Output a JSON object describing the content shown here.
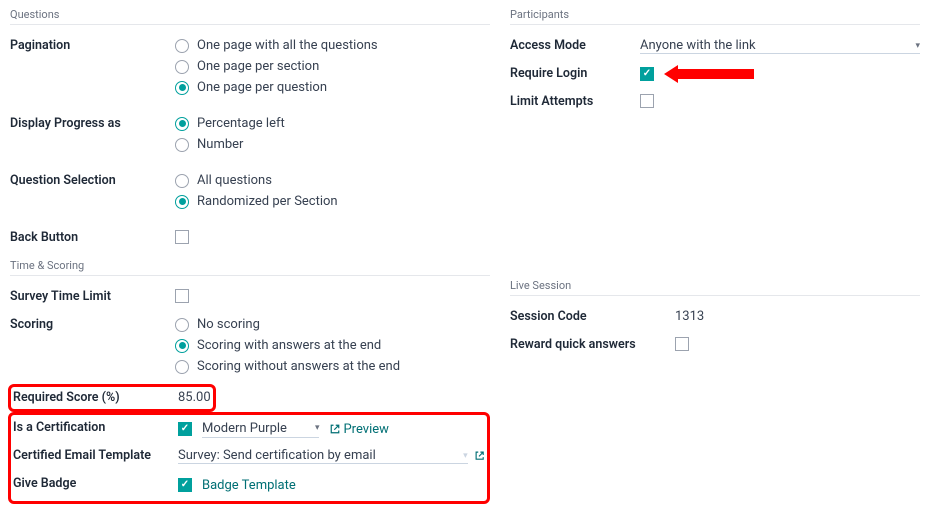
{
  "questions": {
    "section_title": "Questions",
    "pagination": {
      "label": "Pagination",
      "options": [
        {
          "label": "One page with all the questions",
          "selected": false
        },
        {
          "label": "One page per section",
          "selected": false
        },
        {
          "label": "One page per question",
          "selected": true
        }
      ]
    },
    "display_progress": {
      "label": "Display Progress as",
      "options": [
        {
          "label": "Percentage left",
          "selected": true
        },
        {
          "label": "Number",
          "selected": false
        }
      ]
    },
    "question_selection": {
      "label": "Question Selection",
      "options": [
        {
          "label": "All questions",
          "selected": false
        },
        {
          "label": "Randomized per Section",
          "selected": true
        }
      ]
    },
    "back_button": {
      "label": "Back Button",
      "checked": false
    }
  },
  "participants": {
    "section_title": "Participants",
    "access_mode": {
      "label": "Access Mode",
      "value": "Anyone with the link"
    },
    "require_login": {
      "label": "Require Login",
      "checked": true
    },
    "limit_attempts": {
      "label": "Limit Attempts",
      "checked": false
    }
  },
  "time_scoring": {
    "section_title": "Time & Scoring",
    "survey_time_limit": {
      "label": "Survey Time Limit",
      "checked": false
    },
    "scoring": {
      "label": "Scoring",
      "options": [
        {
          "label": "No scoring",
          "selected": false
        },
        {
          "label": "Scoring with answers at the end",
          "selected": true
        },
        {
          "label": "Scoring without answers at the end",
          "selected": false
        }
      ]
    },
    "required_score": {
      "label": "Required Score (%)",
      "value": "85.00"
    },
    "is_certification": {
      "label": "Is a Certification",
      "checked": true,
      "template": "Modern Purple",
      "preview_label": "Preview"
    },
    "certified_email": {
      "label": "Certified Email Template",
      "value": "Survey: Send certification by email"
    },
    "give_badge": {
      "label": "Give Badge",
      "checked": true,
      "link_label": "Badge Template"
    }
  },
  "live_session": {
    "section_title": "Live Session",
    "session_code": {
      "label": "Session Code",
      "value": "1313"
    },
    "reward_quick": {
      "label": "Reward quick answers",
      "checked": false
    }
  }
}
